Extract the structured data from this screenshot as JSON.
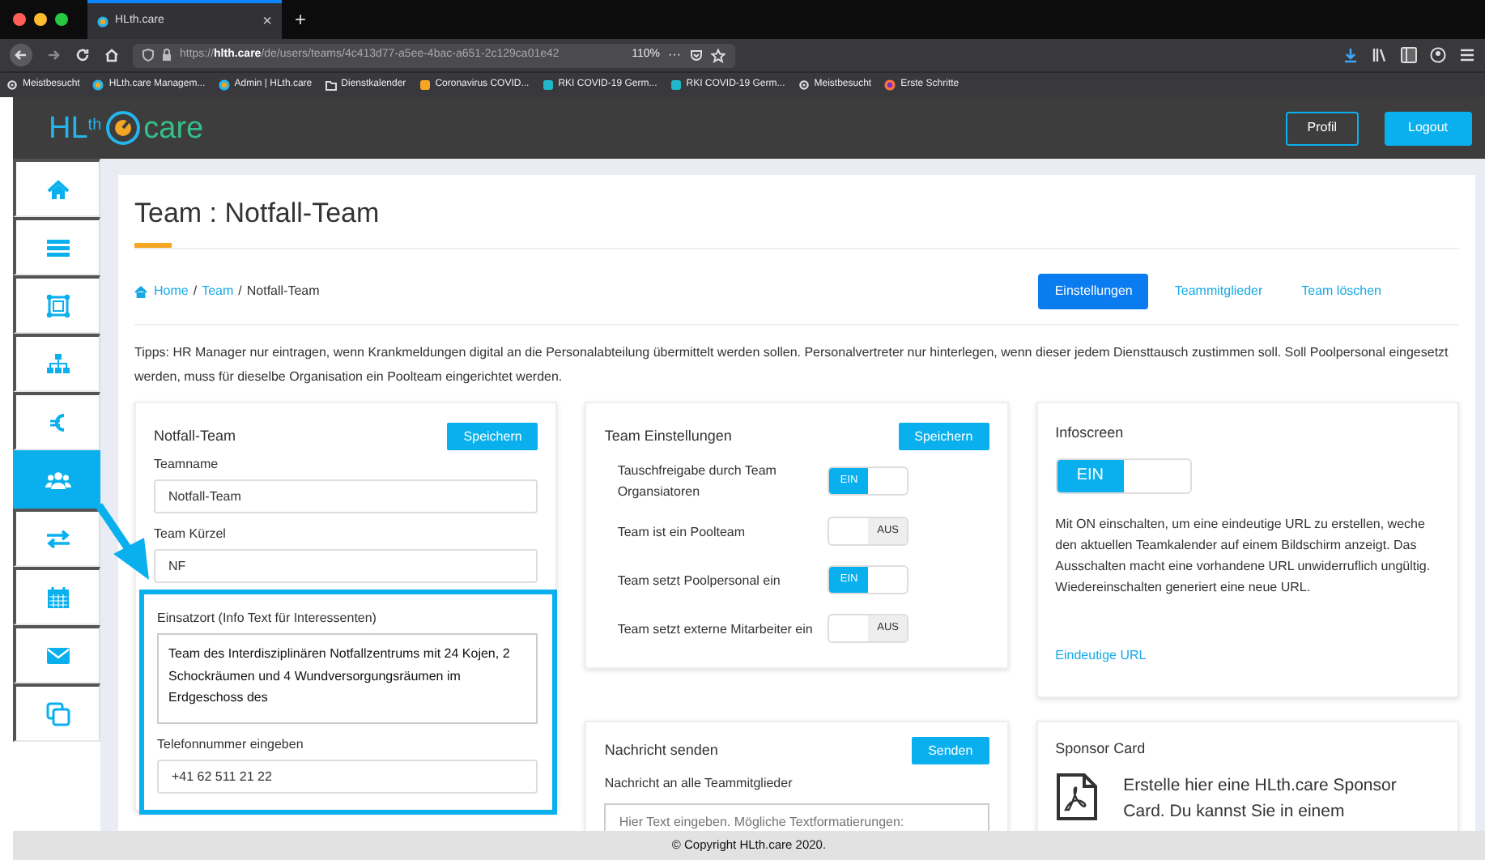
{
  "browser": {
    "tabs": [
      {
        "title": "HLth.care",
        "selected": true
      }
    ],
    "new_tab": "+",
    "close": "×",
    "url": "https://**hlth.care**/de/users/teams/4c413d77-a5ee-4bac-a651-2c129ca01e42",
    "zoom": "110%",
    "more": "···",
    "bookmarks": [
      {
        "kind": "gear",
        "label": "Meistbesucht"
      },
      {
        "kind": "site",
        "label": "HLth.care Managem..."
      },
      {
        "kind": "site",
        "label": "Admin | HLth.care"
      },
      {
        "kind": "folder",
        "label": "Dienstkalender"
      },
      {
        "kind": "orange",
        "label": "Coronavirus COVID..."
      },
      {
        "kind": "teal",
        "label": "RKI COVID-19 Germ..."
      },
      {
        "kind": "teal",
        "label": "RKI COVID-19 Germ..."
      },
      {
        "kind": "gear",
        "label": "Meistbesucht"
      },
      {
        "kind": "fox",
        "label": "Erste Schritte"
      }
    ]
  },
  "header": {
    "logo_left": "HL$^{th}$",
    "logo_right": "care",
    "buttons": [
      {
        "label": "Profil",
        "kind": "outline"
      },
      {
        "label": "Logout",
        "kind": "solid"
      }
    ]
  },
  "sidebar": {
    "items": [
      {
        "kind": "home",
        "selected": false
      },
      {
        "kind": "list",
        "selected": false
      },
      {
        "kind": "frame",
        "selected": false
      },
      {
        "kind": "sitemap",
        "selected": false
      },
      {
        "kind": "euro",
        "selected": false
      },
      {
        "kind": "users",
        "selected": true
      },
      {
        "kind": "exchange",
        "selected": false
      },
      {
        "kind": "calendar",
        "selected": false
      },
      {
        "kind": "mail",
        "selected": false
      },
      {
        "kind": "copy",
        "selected": false
      }
    ]
  },
  "page": {
    "title": "Team : Notfall-Team",
    "breadcrumb": [
      {
        "label": "Home",
        "link": true
      },
      {
        "label": "Team",
        "link": true
      },
      {
        "label": "Notfall-Team",
        "link": false
      }
    ],
    "breadcrumb_separator": "/",
    "tabs": [
      {
        "label": "Einstellungen",
        "selected": true
      },
      {
        "label": "Teammitglieder",
        "selected": false
      },
      {
        "label": "Team löschen",
        "selected": false
      }
    ],
    "tips": "Tipps: HR Manager nur eintragen, wenn Krankmeldungen digital an die Personalabteilung übermittelt werden sollen. Personalvertreter nur hinterlegen, wenn dieser jedem Diensttausch zustimmen soll. Soll Poolpersonal eingesetzt werden, muss für dieselbe Organisation ein Poolteam eingerichtet werden.",
    "team_card": {
      "title": "Notfall-Team",
      "button": "Speichern",
      "fields": [
        {
          "label": "Teamname",
          "value": "Notfall-Team",
          "kind": "input",
          "highlighted": false
        },
        {
          "label": "Team Kürzel",
          "value": "NF",
          "kind": "input",
          "highlighted": false
        },
        {
          "label": "Einsatzort (Info Text für Interessenten)",
          "value": "Team des Interdisziplinären Notfallzentrums mit 24 Kojen, 2 Schockräumen und 4 Wundversorgungsräumen im Erdgeschoss des",
          "kind": "textarea",
          "highlighted": true
        },
        {
          "label": "Telefonnummer eingeben",
          "value": "+41 62 511 21 22",
          "kind": "input",
          "highlighted": true
        }
      ]
    },
    "settings_card": {
      "title": "Team Einstellungen",
      "button": "Speichern",
      "toggles": [
        {
          "label": "Tauschfreigabe durch Team Organsiatoren",
          "on": true,
          "state_text": "EIN"
        },
        {
          "label": "Team ist ein Poolteam",
          "on": false,
          "state_text": "AUS"
        },
        {
          "label": "Team setzt Poolpersonal ein",
          "on": true,
          "state_text": "EIN"
        },
        {
          "label": "Team setzt externe Mitarbeiter ein",
          "on": false,
          "state_text": "AUS"
        }
      ]
    },
    "infoscreen_card": {
      "title": "Infoscreen",
      "toggle": {
        "on": true,
        "state_text": "EIN"
      },
      "text": "Mit ON einschalten, um eine eindeutige URL zu erstellen, weche den aktuellen Teamkalender auf einem Bildschirm anzeigt. Das Ausschalten macht eine vorhandene URL unwiderruflich ungültig. Wiedereinschalten generiert eine neue URL.",
      "link": "Eindeutige URL"
    },
    "message_card": {
      "title": "Nachricht senden",
      "button": "Senden",
      "label": "Nachricht an alle Teammitglieder",
      "placeholder": "Hier Text eingeben. Mögliche Textformatierungen:"
    },
    "sponsor_card": {
      "title": "Sponsor Card",
      "text": "Erstelle hier eine HLth.care Sponsor Card. Du kannst Sie in einem"
    }
  },
  "footer": "© Copyright HLth.care 2020."
}
